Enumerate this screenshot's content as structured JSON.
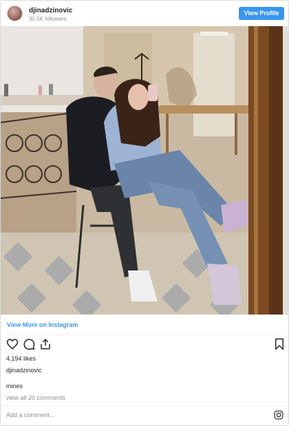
{
  "header": {
    "username": "djinadzinovic",
    "followers": "30.5K followers",
    "view_profile_label": "View Profile"
  },
  "post": {
    "view_more_label": "View More on Instagram",
    "likes": "4,194 likes",
    "caption_user": "djinadzinovic",
    "caption": "mines",
    "comments_link": "view all 20 comments",
    "comment_placeholder": "Add a comment...",
    "icons": [
      "heart-icon",
      "comment-icon",
      "share-icon",
      "bookmark-icon",
      "instagram-icon"
    ]
  },
  "colors": {
    "accent": "#3897f0",
    "text": "#262626",
    "muted": "#8e8e8e",
    "border": "#dbdbdb"
  }
}
